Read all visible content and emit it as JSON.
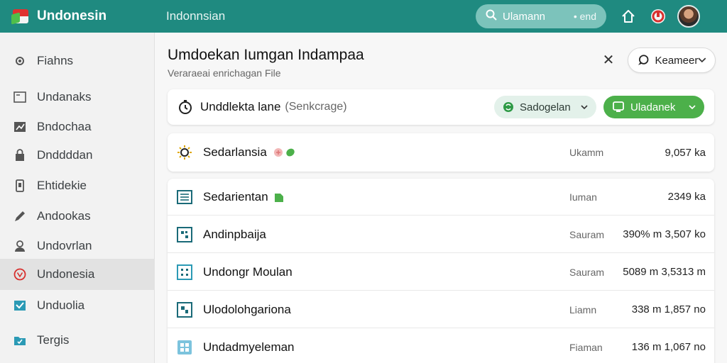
{
  "app": {
    "brand": "Undonesin",
    "title": "Indonnsian"
  },
  "search": {
    "query": "Ulamann",
    "end_label": "• end"
  },
  "sidebar": {
    "items": [
      {
        "label": "Fiahns",
        "icon": "gear-icon"
      },
      {
        "label": "Undanaks",
        "icon": "window-icon"
      },
      {
        "label": "Bndochaa",
        "icon": "chart-icon"
      },
      {
        "label": "Dnddddan",
        "icon": "lock-icon"
      },
      {
        "label": "Ehtidekie",
        "icon": "phone-icon"
      },
      {
        "label": "Andookas",
        "icon": "pencil-icon"
      },
      {
        "label": "Undovrlan",
        "icon": "user-icon"
      },
      {
        "label": "Undonesia",
        "icon": "brand-circle-icon",
        "active": true
      },
      {
        "label": "Unduolia",
        "icon": "inbox-icon"
      },
      {
        "label": "Tergis",
        "icon": "folder-icon"
      }
    ]
  },
  "main": {
    "title": "Umdoekan Iumgan Indampaa",
    "subtitle": "Veraraeai enrichagan File",
    "filter_label": "Keameer",
    "toolbar": {
      "name": "Unddlekta lane",
      "sub": "(Senkcrage)",
      "pill_light": "Sadogelan",
      "pill_green": "Uladanek"
    },
    "highlight": {
      "name": "Sedarlansia",
      "type": "Ukamm",
      "size": "9,057 ka"
    },
    "rows": [
      {
        "name": "Sedarientan",
        "type": "Iuman",
        "size": "2349 ka",
        "icon": "table-icon"
      },
      {
        "name": "Andinpbaija",
        "type": "Sauram",
        "size": "390% m  3,507 ko",
        "icon": "grid-icon"
      },
      {
        "name": "Undongr Moulan",
        "type": "Sauram",
        "size": "5089 m  3,5313 m",
        "icon": "grid-icon"
      },
      {
        "name": "Ulodolohgariona",
        "type": "Liamn",
        "size": "338 m  1,857 no",
        "icon": "grid-icon"
      },
      {
        "name": "Undadmyeleman",
        "type": "Fiaman",
        "size": "136 m  1,067 no",
        "icon": "grid-icon"
      }
    ]
  },
  "colors": {
    "topbar": "#1f8a80",
    "accent_green": "#4cb04a",
    "active_sidebar": "#e2e2e2"
  }
}
